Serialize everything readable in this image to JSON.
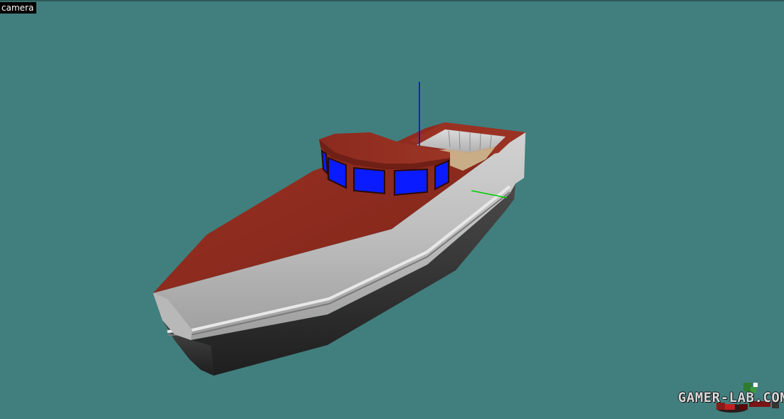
{
  "viewport": {
    "label": "camera",
    "background_color": "#417f7e"
  },
  "colors": {
    "hull_red": "#8e2a1f",
    "hull_white": "#c9c9c9",
    "hull_dark": "#2a2a2a",
    "window_blue": "#0a1cff",
    "axis_z": "#0000ff",
    "axis_y": "#00cc00"
  },
  "watermark": {
    "text": "GAMER-LAB.COM"
  }
}
